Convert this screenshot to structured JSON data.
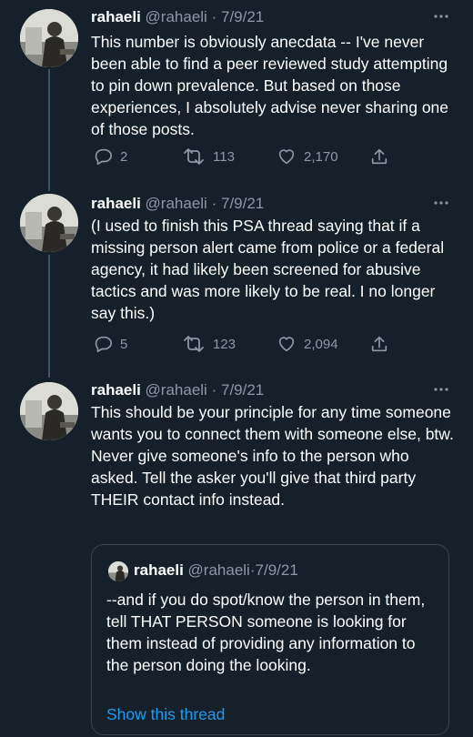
{
  "tweets": [
    {
      "name": "rahaeli",
      "handle": "@rahaeli",
      "dot": "·",
      "date": "7/9/21",
      "text": "This number is obviously anecdata -- I've never been able to find a peer reviewed study attempting to pin down prevalence. But based on those experiences, I absolutely advise never sharing one of those posts.",
      "replies": "2",
      "retweets": "113",
      "likes": "2,170"
    },
    {
      "name": "rahaeli",
      "handle": "@rahaeli",
      "dot": "·",
      "date": "7/9/21",
      "text": "(I used to finish this PSA thread saying that if a missing person alert came from police or a federal agency, it had likely been screened for abusive tactics and was more likely to be real. I no longer say this.)",
      "replies": "5",
      "retweets": "123",
      "likes": "2,094"
    },
    {
      "name": "rahaeli",
      "handle": "@rahaeli",
      "dot": "·",
      "date": "7/9/21",
      "text": "This should be your principle for any time someone wants you to connect them with someone else, btw. Never give someone's info to the person who asked. Tell the asker you'll give that third party THEIR contact info instead."
    }
  ],
  "quote": {
    "name": "rahaeli",
    "handle": "@rahaeli",
    "dot": "·",
    "date": "7/9/21",
    "text": "--and if you do spot/know the person in them, tell THAT PERSON someone is looking for them instead of providing any information to the person doing the looking.",
    "show_thread": "Show this thread"
  },
  "colors": {
    "background": "#15202b",
    "secondary_text": "#8b98a5",
    "link": "#1d9bf0",
    "border": "#38444d"
  },
  "icons": [
    "reply-icon",
    "retweet-icon",
    "like-icon",
    "share-icon",
    "more-icon"
  ]
}
